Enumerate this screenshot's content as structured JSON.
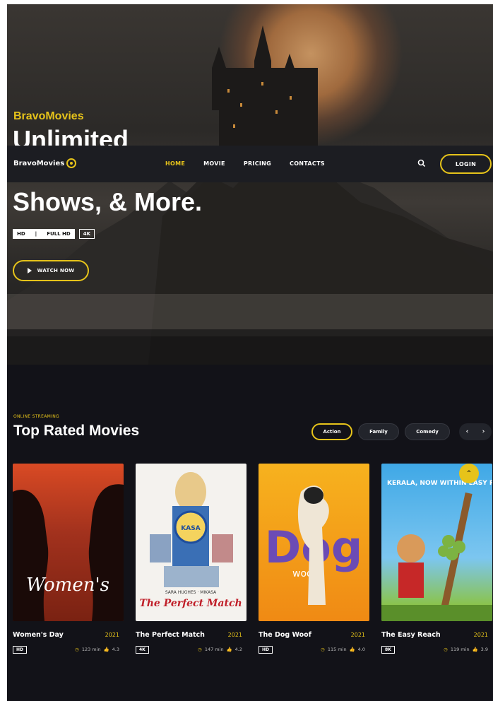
{
  "hero": {
    "brand": "BravoMovies",
    "headline_top": "Unlimited",
    "headline_bottom": "Shows, & More.",
    "quality": [
      "HD",
      "|",
      "FULL HD"
    ],
    "quality_4k": "4K",
    "watch_label": "WATCH NOW"
  },
  "nav": {
    "logo": "BravoMovies",
    "items": [
      "HOME",
      "MOVIE",
      "PRICING",
      "CONTACTS"
    ],
    "login": "LOGIN"
  },
  "section": {
    "eyebrow": "ONLINE STREAMING",
    "title": "Top Rated Movies",
    "filters": [
      "Action",
      "Family",
      "Comedy"
    ],
    "prev": "‹",
    "next": "›"
  },
  "movies": [
    {
      "title": "Women's Day",
      "year": "2021",
      "badge": "HD",
      "duration": "123 min",
      "rating": "4.3",
      "poster_text": "Women's"
    },
    {
      "title": "The Perfect Match",
      "year": "2021",
      "badge": "4K",
      "duration": "147 min",
      "rating": "4.2",
      "poster_text": "The Perfect Match",
      "poster_sub": "SARA HUGHES · MIKASA",
      "poster_top": "KASA"
    },
    {
      "title": "The Dog Woof",
      "year": "2021",
      "badge": "HD",
      "duration": "115 min",
      "rating": "4.0",
      "poster_text": "Dog",
      "poster_sub": "woof"
    },
    {
      "title": "The Easy Reach",
      "year": "2021",
      "badge": "8K",
      "duration": "119 min",
      "rating": "3.9",
      "poster_text": "KERALA, NOW WITHIN EASY REACH"
    }
  ],
  "colors": {
    "accent": "#e6c31a",
    "bg": "#121218",
    "nav": "#1c1d22"
  }
}
